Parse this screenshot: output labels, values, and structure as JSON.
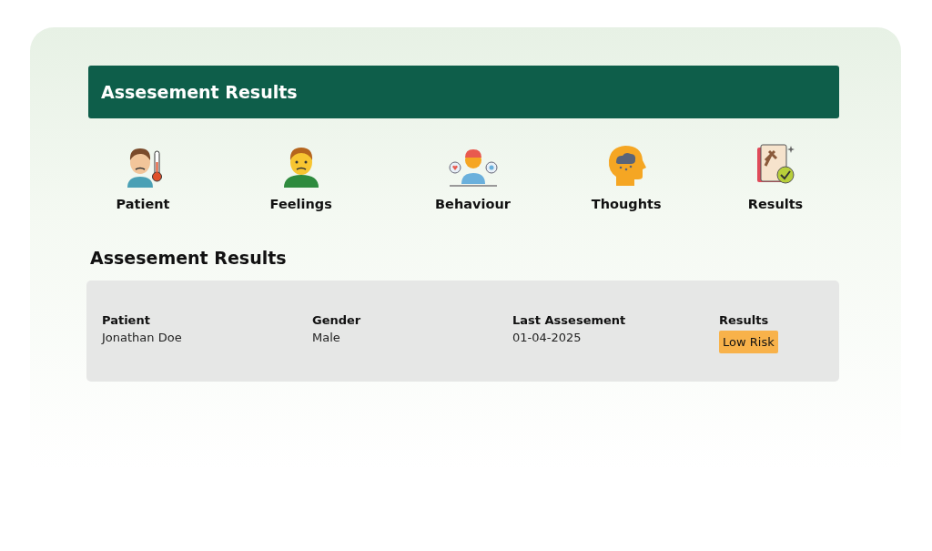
{
  "header": {
    "title": "Assesement Results"
  },
  "steps": [
    {
      "label": "Patient",
      "kind": "patient"
    },
    {
      "label": "Feelings",
      "kind": "feelings"
    },
    {
      "label": "Behaviour",
      "kind": "behaviour"
    },
    {
      "label": "Thoughts",
      "kind": "thoughts"
    },
    {
      "label": "Results",
      "kind": "results"
    }
  ],
  "section_title": "Assesement Results",
  "summary": {
    "columns": [
      {
        "heading": "Patient",
        "value": "Jonathan Doe",
        "kind": "text"
      },
      {
        "heading": "Gender",
        "value": "Male",
        "kind": "text"
      },
      {
        "heading": "Last Assesement",
        "value": "01-04-2025",
        "kind": "text"
      },
      {
        "heading": "Results",
        "value": "Low Risk",
        "kind": "badge"
      }
    ]
  }
}
